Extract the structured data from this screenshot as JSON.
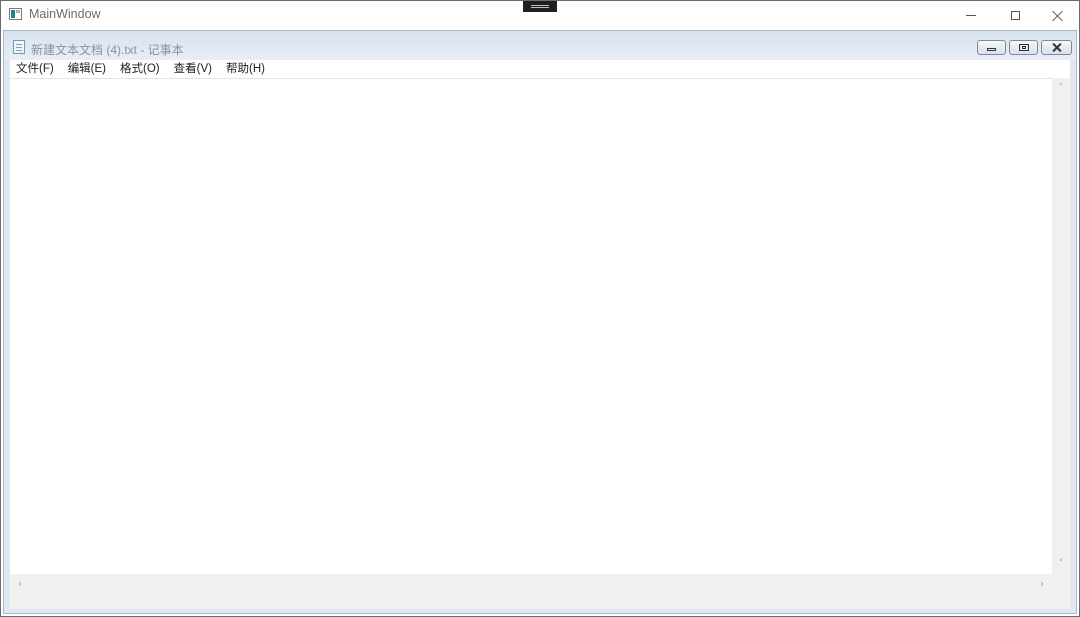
{
  "outer_window": {
    "title": "MainWindow",
    "icons": {
      "app": "app-window-icon",
      "drag": "drag-handle-icon"
    },
    "controls": {
      "minimize": "minimize-icon",
      "maximize": "maximize-icon",
      "close": "close-icon"
    }
  },
  "notepad": {
    "title": "新建文本文档 (4).txt - 记事本",
    "icon": "notepad-icon",
    "controls": {
      "minimize": "minimize-icon",
      "restore": "restore-icon",
      "close": "close-icon"
    },
    "menu": [
      {
        "label": "文件(F)"
      },
      {
        "label": "编辑(E)"
      },
      {
        "label": "格式(O)"
      },
      {
        "label": "查看(V)"
      },
      {
        "label": "帮助(H)"
      }
    ],
    "content": "",
    "scrollbars": {
      "up_arrow": "˄",
      "down_arrow": "˅",
      "left_arrow": "‹",
      "right_arrow": "›"
    }
  },
  "colors": {
    "inner_frame": "#dfe8f1",
    "titlebar_top": "#d8e3ee",
    "scrollbar": "#f0f0f0"
  }
}
